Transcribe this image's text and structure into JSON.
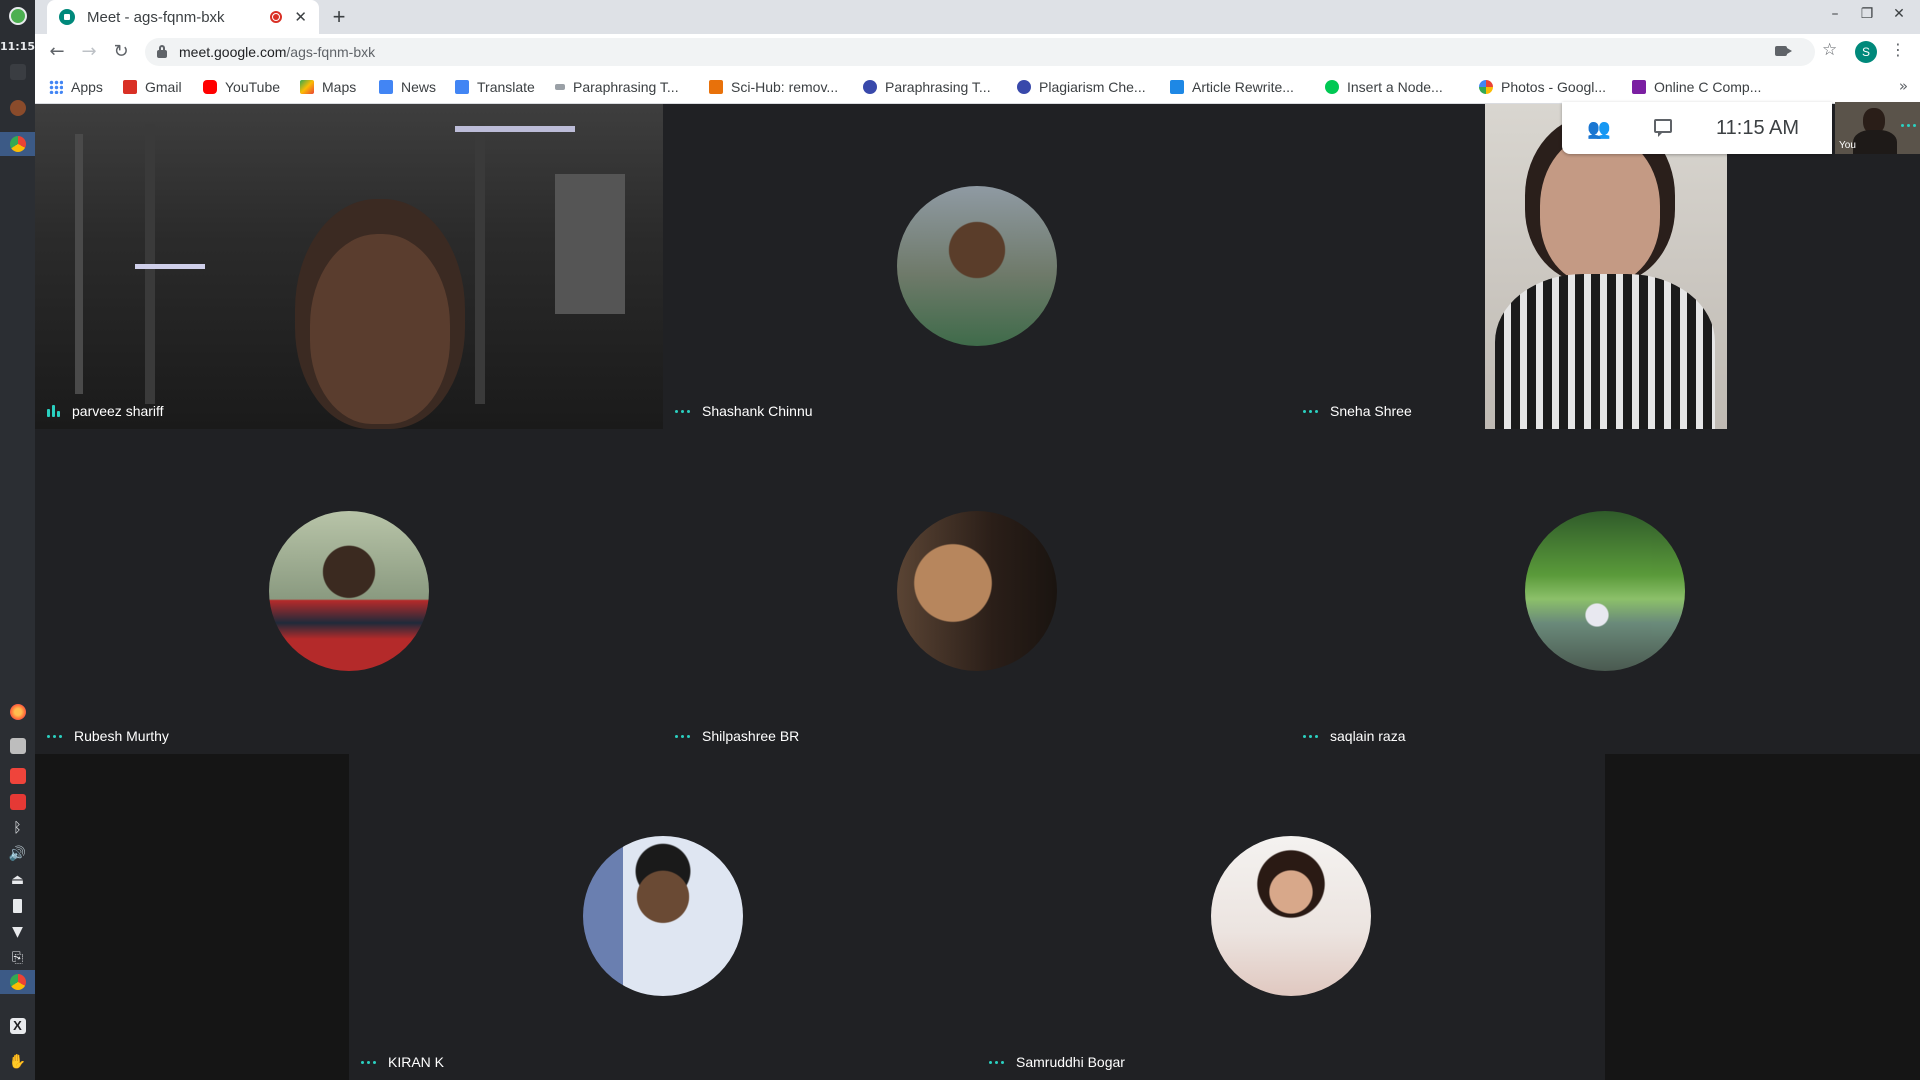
{
  "dock": {
    "clock": "11:15"
  },
  "browser": {
    "tab_title": "Meet - ags-fqnm-bxk",
    "url_host": "meet.google.com",
    "url_path": "/ags-fqnm-bxk",
    "profile_initial": "S",
    "bookmarks": [
      {
        "label": "Apps",
        "icon": "apps-grid-icon",
        "color": "#4285f4"
      },
      {
        "label": "Gmail",
        "icon": "gmail-icon",
        "color": "#d93025"
      },
      {
        "label": "YouTube",
        "icon": "youtube-icon",
        "color": "#ff0000"
      },
      {
        "label": "Maps",
        "icon": "maps-icon",
        "color": "#34a853"
      },
      {
        "label": "News",
        "icon": "news-icon",
        "color": "#4285f4"
      },
      {
        "label": "Translate",
        "icon": "translate-icon",
        "color": "#4285f4"
      },
      {
        "label": "Paraphrasing T...",
        "icon": "paraphrasing-icon",
        "color": "#5f6368"
      },
      {
        "label": "Sci-Hub: remov...",
        "icon": "scihub-icon",
        "color": "#e8710a"
      },
      {
        "label": "Paraphrasing T...",
        "icon": "paraphrasing-tool-icon",
        "color": "#3949ab"
      },
      {
        "label": "Plagiarism Che...",
        "icon": "plagiarism-icon",
        "color": "#3949ab"
      },
      {
        "label": "Article Rewrite...",
        "icon": "article-rewriter-icon",
        "color": "#1e88e5"
      },
      {
        "label": "Insert a Node...",
        "icon": "insert-node-icon",
        "color": "#00c853"
      },
      {
        "label": "Photos - Googl...",
        "icon": "photos-icon",
        "color": "#fbbc04"
      },
      {
        "label": "Online C Comp...",
        "icon": "online-c-icon",
        "color": "#7b1fa2"
      }
    ]
  },
  "meet": {
    "time": "11:15 AM",
    "self_label": "You",
    "participants": [
      {
        "name": "parveez shariff",
        "mode": "video",
        "speaking": true
      },
      {
        "name": "Shashank Chinnu",
        "mode": "avatar"
      },
      {
        "name": "Sneha Shree",
        "mode": "video"
      },
      {
        "name": "Rubesh Murthy",
        "mode": "avatar"
      },
      {
        "name": "Shilpashree BR",
        "mode": "avatar"
      },
      {
        "name": "saqlain raza",
        "mode": "avatar"
      },
      {
        "name": "KIRAN K",
        "mode": "avatar"
      },
      {
        "name": "Samruddhi Bogar",
        "mode": "avatar"
      }
    ]
  }
}
